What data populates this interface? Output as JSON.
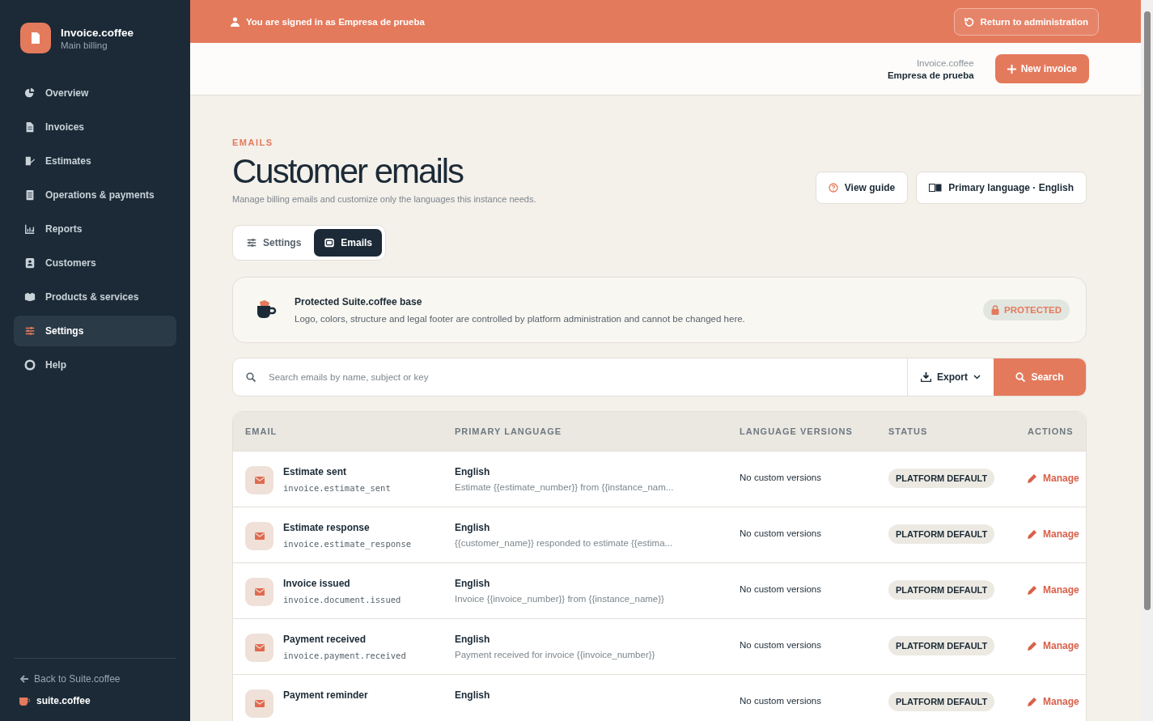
{
  "sidebar": {
    "brand": {
      "title": "Invoice.coffee",
      "subtitle": "Main billing"
    },
    "items": [
      {
        "label": "Overview",
        "selected": false
      },
      {
        "label": "Invoices",
        "selected": false
      },
      {
        "label": "Estimates",
        "selected": false
      },
      {
        "label": "Operations & payments",
        "selected": false
      },
      {
        "label": "Reports",
        "selected": false
      },
      {
        "label": "Customers",
        "selected": false
      },
      {
        "label": "Products & services",
        "selected": false
      },
      {
        "label": "Settings",
        "selected": true
      },
      {
        "label": "Help",
        "selected": false
      }
    ],
    "back_link": "Back to Suite.coffee",
    "footer_brand": "suite.coffee"
  },
  "banner": {
    "message": "You are signed in as Empresa de prueba",
    "button": "Return to administration"
  },
  "header": {
    "instance": "Invoice.coffee",
    "company": "Empresa de prueba",
    "button": "New invoice"
  },
  "page": {
    "eyebrow": "EMAILS",
    "title": "Customer emails",
    "subtitle": "Manage billing emails and customize only the languages this instance needs.",
    "guide_button": "View guide",
    "language_button": "Primary language · English"
  },
  "tabs": [
    {
      "label": "Settings",
      "selected": false
    },
    {
      "label": "Emails",
      "selected": true
    }
  ],
  "notice": {
    "title": "Protected Suite.coffee base",
    "text": "Logo, colors, structure and legal footer are controlled by platform administration and cannot be changed here.",
    "badge": "PROTECTED"
  },
  "search": {
    "placeholder": "Search emails by name, subject or key",
    "export": "Export",
    "button": "Search"
  },
  "table": {
    "columns": [
      "EMAIL",
      "PRIMARY LANGUAGE",
      "LANGUAGE VERSIONS",
      "STATUS",
      "ACTIONS"
    ],
    "rows": [
      {
        "name": "Estimate sent",
        "key": "invoice.estimate_sent",
        "language": "English",
        "subject": "Estimate {{estimate_number}} from {{instance_nam...",
        "versions": "No custom versions",
        "status": "PLATFORM DEFAULT",
        "action": "Manage"
      },
      {
        "name": "Estimate response",
        "key": "invoice.estimate_response",
        "language": "English",
        "subject": "{{customer_name}} responded to estimate {{estima...",
        "versions": "No custom versions",
        "status": "PLATFORM DEFAULT",
        "action": "Manage"
      },
      {
        "name": "Invoice issued",
        "key": "invoice.document.issued",
        "language": "English",
        "subject": "Invoice {{invoice_number}} from {{instance_name}}",
        "versions": "No custom versions",
        "status": "PLATFORM DEFAULT",
        "action": "Manage"
      },
      {
        "name": "Payment received",
        "key": "invoice.payment.received",
        "language": "English",
        "subject": "Payment received for invoice {{invoice_number}}",
        "versions": "No custom versions",
        "status": "PLATFORM DEFAULT",
        "action": "Manage"
      },
      {
        "name": "Payment reminder",
        "language": "English",
        "versions": "No custom versions",
        "status": "PLATFORM DEFAULT",
        "action": "Manage"
      }
    ]
  }
}
